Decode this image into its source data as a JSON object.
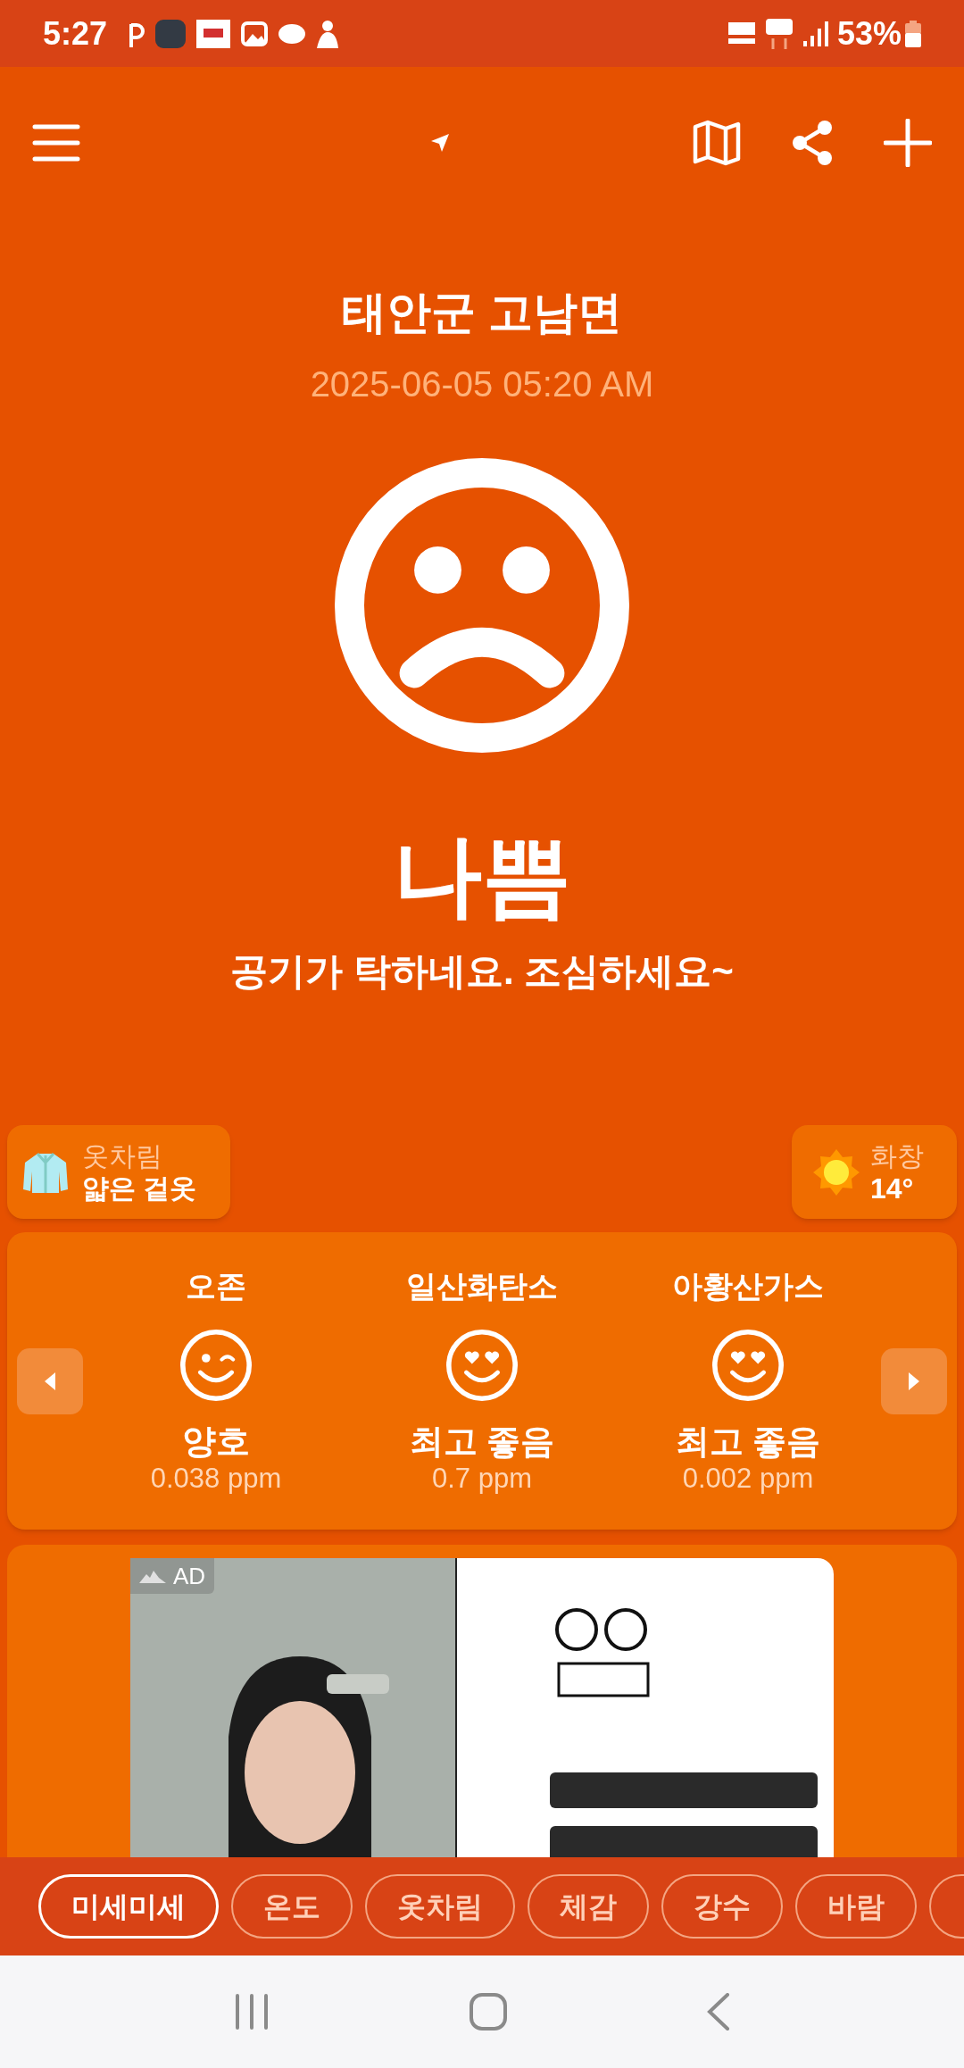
{
  "status_bar": {
    "time": "5:27",
    "battery": "53%"
  },
  "location": {
    "title": "태안군 고남면",
    "updated": "2025-06-05 05:20 AM"
  },
  "grade": {
    "kind": "sad",
    "label": "나쁨",
    "message": "공기가 탁하네요. 조심하세요~"
  },
  "clothing": {
    "label": "옷차림",
    "value": "얇은 겉옷"
  },
  "weather": {
    "label": "화창",
    "value": "14°"
  },
  "pollutants": [
    {
      "name": "오존",
      "kind": "wink",
      "status": "양호",
      "value": "0.038 ppm"
    },
    {
      "name": "일산화탄소",
      "kind": "love",
      "status": "최고 좋음",
      "value": "0.7 ppm"
    },
    {
      "name": "아황산가스",
      "kind": "love",
      "status": "최고 좋음",
      "value": "0.002 ppm"
    }
  ],
  "ad": {
    "badge": "AD",
    "kind": "picture"
  },
  "tabs": [
    {
      "label": "미세미세",
      "selected": true
    },
    {
      "label": "온도",
      "selected": false
    },
    {
      "label": "옷차림",
      "selected": false
    },
    {
      "label": "체감",
      "selected": false
    },
    {
      "label": "강수",
      "selected": false
    },
    {
      "label": "바람",
      "selected": false
    }
  ]
}
